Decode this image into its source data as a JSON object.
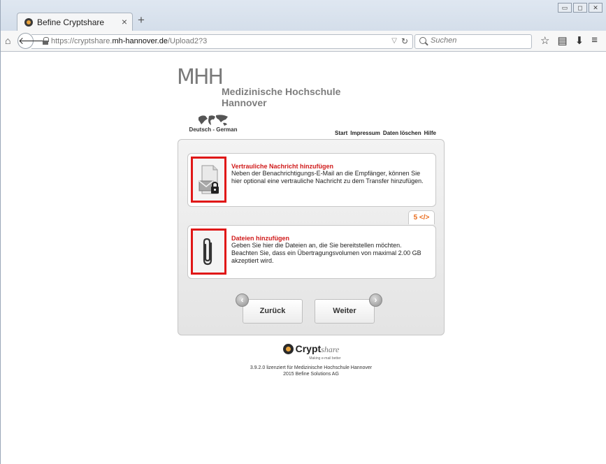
{
  "browser": {
    "tab_title": "Befine Cryptshare",
    "tab_close": "×",
    "new_tab": "+",
    "url_prefix": "https://cryptshare.",
    "url_domain": "mh-hannover.de",
    "url_path": "/Upload2?3",
    "search_placeholder": "Suchen",
    "icons": [
      "home-icon",
      "back-icon",
      "lock-icon",
      "reload-icon",
      "search-icon",
      "star-icon",
      "reading-list-icon",
      "download-icon",
      "menu-icon"
    ]
  },
  "header": {
    "logo_mark": "MHH",
    "logo_line1": "Medizinische Hochschule",
    "logo_line2": "Hannover",
    "language_label": "Deutsch - German",
    "nav": [
      "Start",
      "Impressum",
      "Daten löschen",
      "Hilfe"
    ]
  },
  "cards": [
    {
      "title": "Vertrauliche Nachricht hinzufügen",
      "text": "Neben der Benachrichtigungs-E-Mail an die Empfänger, können Sie hier optional eine vertrauliche Nachricht zu dem Transfer hinzufügen.",
      "icon": "secure-mail-icon"
    },
    {
      "title": "Dateien hinzufügen",
      "text": "Geben Sie hier die Dateien an, die Sie bereitstellen möchten. Beachten Sie, dass ein Übertragungsvolumen von maximal 2.00 GB akzeptiert wird.",
      "icon": "paperclip-icon"
    }
  ],
  "html5_badge": "5 </>",
  "buttons": {
    "back": "Zurück",
    "next": "Weiter"
  },
  "footer": {
    "brand_bold": "Crypt",
    "brand_italic": "share",
    "tagline": "Making e-mail better",
    "license_line1": "3.9.2.0 lizenziert für Medizinische Hochschule Hannover",
    "license_line2": "2015 Befine Solutions AG"
  },
  "colors": {
    "accent_red": "#d01a1a",
    "highlight_border": "#e01818",
    "html5_orange": "#e86a1a"
  }
}
